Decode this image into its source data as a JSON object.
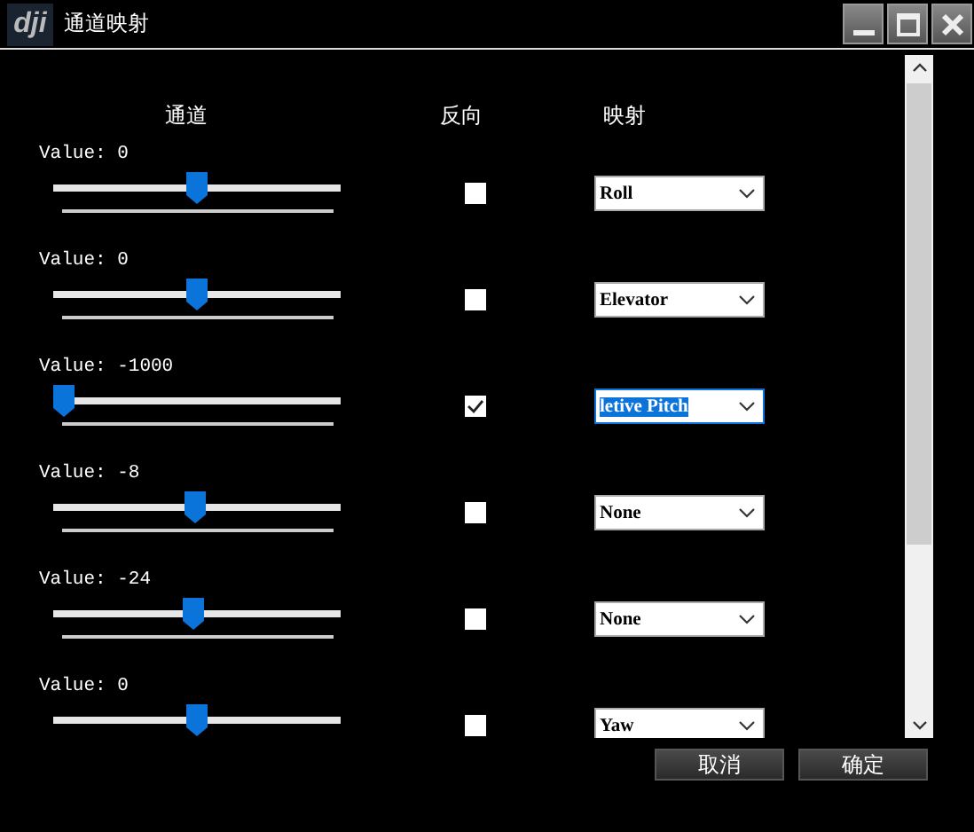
{
  "window": {
    "logo": "dji",
    "title": "通道映射"
  },
  "headers": [
    "通道",
    "反向",
    "映射"
  ],
  "channels": [
    {
      "reading": "Value: 0",
      "level": 0.5,
      "reversed": false,
      "mapping": "Roll",
      "focused": false
    },
    {
      "reading": "Value: 0",
      "level": 0.5,
      "reversed": false,
      "mapping": "Elevator",
      "focused": false
    },
    {
      "reading": "Value: -1000",
      "level": 0,
      "reversed": true,
      "mapping": "letive Pitch",
      "focused": true
    },
    {
      "reading": "Value: -8",
      "level": 0.496,
      "reversed": false,
      "mapping": "None",
      "focused": false
    },
    {
      "reading": "Value: -24",
      "level": 0.488,
      "reversed": false,
      "mapping": "None",
      "focused": false
    },
    {
      "reading": "Value: 0",
      "level": 0.5,
      "reversed": false,
      "mapping": "Yaw",
      "focused": false
    }
  ],
  "buttons": [
    "取消",
    "确定"
  ]
}
